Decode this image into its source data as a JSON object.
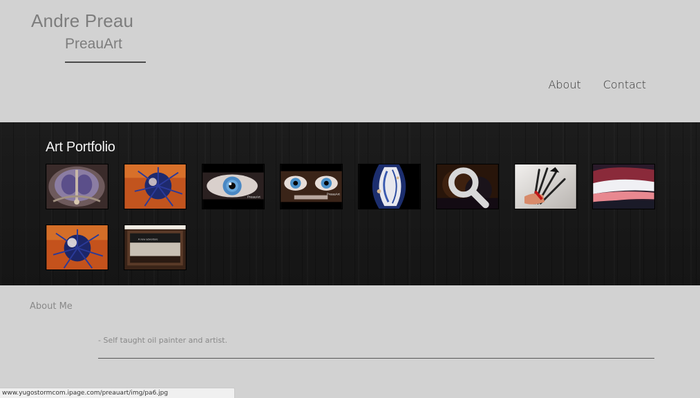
{
  "header": {
    "site_name": "Andre Preau",
    "site_subtitle": "PreauArt"
  },
  "nav": {
    "items": [
      {
        "label": "About"
      },
      {
        "label": "Contact"
      }
    ]
  },
  "portfolio": {
    "title": "Art Portfolio",
    "thumbnails": [
      {
        "name": "Art Portfolio 1",
        "kind": "symmetrical purple painting"
      },
      {
        "name": "Art Portfolio 2",
        "kind": "orange and blue spiky figure"
      },
      {
        "name": "Art Portfolio 3",
        "kind": "blue eye",
        "caption": "PreauArt"
      },
      {
        "name": "Art Portfolio 4",
        "kind": "two blue eyes",
        "caption": "PreauArt"
      },
      {
        "name": "Art Portfolio 5",
        "kind": "blue and white abstract"
      },
      {
        "name": "Art Portfolio 6",
        "kind": "dark orange painting",
        "hovered": true,
        "overlay_icon": "search-icon"
      },
      {
        "name": "Art Portfolio 7",
        "kind": "hand with brushes"
      },
      {
        "name": "Art Portfolio 8",
        "kind": "pink and white landscape"
      },
      {
        "name": "Art Portfolio 9",
        "kind": "orange and blue spiky figure"
      },
      {
        "name": "Art Portfolio 10",
        "kind": "framed dark panel",
        "caption": "A new adventure"
      }
    ]
  },
  "about": {
    "heading": "About Me",
    "text": "- Self taught oil painter and artist."
  },
  "status_bar": {
    "url": "www.yugostormcom.ipage.com/preauart/img/pa6.jpg"
  }
}
